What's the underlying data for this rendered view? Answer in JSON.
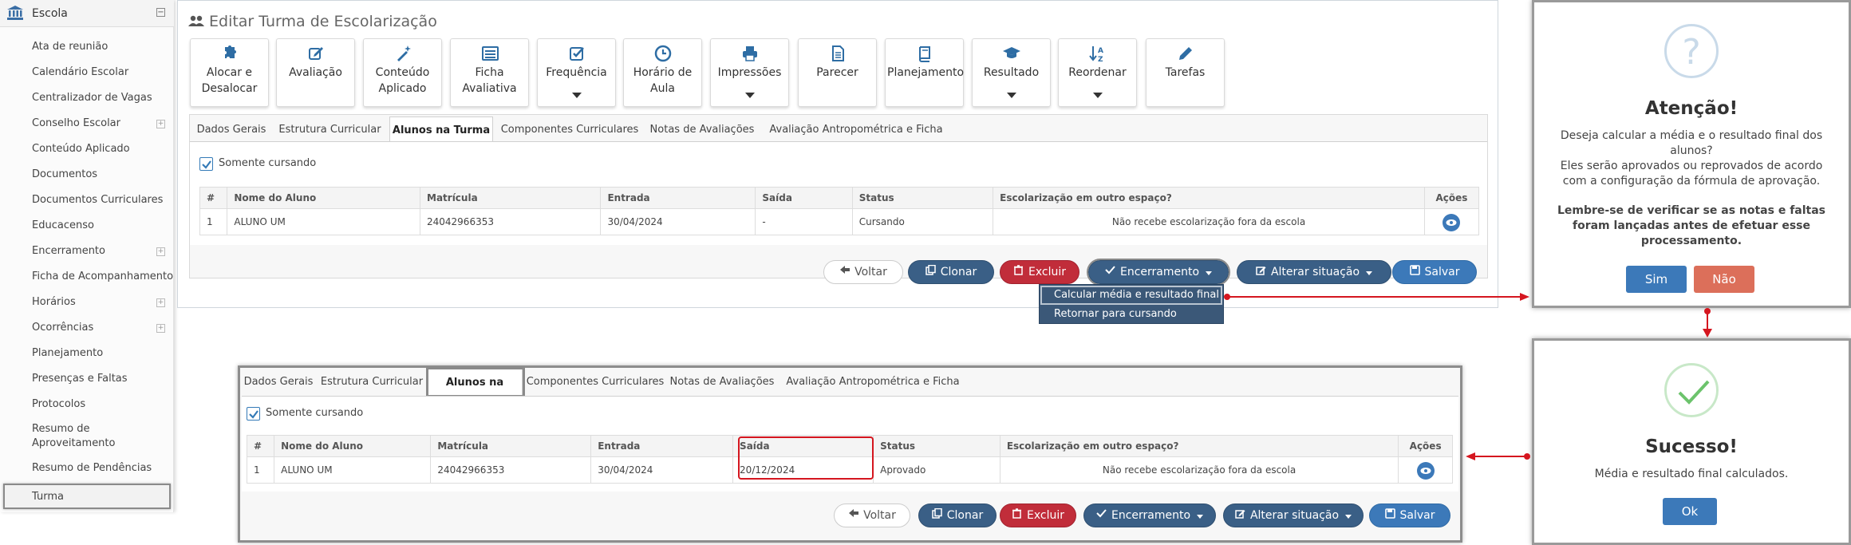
{
  "sidebar": {
    "header": "Escola",
    "items": [
      {
        "label": "Ata de reunião",
        "expandable": false
      },
      {
        "label": "Calendário Escolar",
        "expandable": false
      },
      {
        "label": "Centralizador de Vagas",
        "expandable": false
      },
      {
        "label": "Conselho Escolar",
        "expandable": true
      },
      {
        "label": "Conteúdo Aplicado",
        "expandable": false
      },
      {
        "label": "Documentos",
        "expandable": false
      },
      {
        "label": "Documentos Curriculares",
        "expandable": false
      },
      {
        "label": "Educacenso",
        "expandable": false
      },
      {
        "label": "Encerramento",
        "expandable": true
      },
      {
        "label": "Ficha de Acompanhamento",
        "expandable": false
      },
      {
        "label": "Horários",
        "expandable": true
      },
      {
        "label": "Ocorrências",
        "expandable": true
      },
      {
        "label": "Planejamento",
        "expandable": false
      },
      {
        "label": "Presenças e Faltas",
        "expandable": false
      },
      {
        "label": "Protocolos",
        "expandable": false
      },
      {
        "label": "Resumo de",
        "label2": "Aproveitamento",
        "expandable": false
      },
      {
        "label": "Resumo de Pendências",
        "expandable": false
      },
      {
        "label": "Turma",
        "expandable": false
      }
    ]
  },
  "page": {
    "title": "Editar Turma de Escolarização"
  },
  "toolbar": [
    {
      "l1": "Alocar e",
      "l2": "Desalocar",
      "icon": "puzzle-icon",
      "caret": false
    },
    {
      "l1": "Avaliação",
      "l2": "",
      "icon": "edit-icon",
      "caret": false
    },
    {
      "l1": "Conteúdo",
      "l2": "Aplicado",
      "icon": "magic-wand-icon",
      "caret": false
    },
    {
      "l1": "Ficha",
      "l2": "Avaliativa",
      "icon": "list-icon",
      "caret": false
    },
    {
      "l1": "Frequência",
      "l2": "",
      "icon": "check-square-icon",
      "caret": true
    },
    {
      "l1": "Horário de",
      "l2": "Aula",
      "icon": "clock-icon",
      "caret": false
    },
    {
      "l1": "Impressões",
      "l2": "",
      "icon": "printer-icon",
      "caret": true
    },
    {
      "l1": "Parecer",
      "l2": "",
      "icon": "document-icon",
      "caret": false
    },
    {
      "l1": "Planejamento",
      "l2": "",
      "icon": "book-icon",
      "caret": false
    },
    {
      "l1": "Resultado",
      "l2": "",
      "icon": "graduation-cap-icon",
      "caret": true
    },
    {
      "l1": "Reordenar",
      "l2": "",
      "icon": "sort-az-icon",
      "caret": true
    },
    {
      "l1": "Tarefas",
      "l2": "",
      "icon": "pencil-icon",
      "caret": false
    }
  ],
  "tabs": [
    "Dados Gerais",
    "Estrutura Curricular",
    "Alunos na Turma",
    "Componentes Curriculares",
    "Notas de Avaliações",
    "Avaliação Antropométrica e Ficha Médica"
  ],
  "active_tab": "Alunos na Turma",
  "filter_label": "Somente cursando",
  "table": {
    "headers": [
      "#",
      "Nome do Aluno",
      "Matrícula",
      "Entrada",
      "Saída",
      "Status",
      "Escolarização em outro espaço?",
      "Ações"
    ],
    "row_before": [
      "1",
      "ALUNO UM",
      "24042966353",
      "30/04/2024",
      "-",
      "Cursando",
      "Não recebe escolarização fora da escola"
    ],
    "row_after": [
      "1",
      "ALUNO UM",
      "24042966353",
      "30/04/2024",
      "20/12/2024",
      "Aprovado",
      "Não recebe escolarização fora da escola"
    ]
  },
  "actions": {
    "voltar": "Voltar",
    "clonar": "Clonar",
    "excluir": "Excluir",
    "encerramento": "Encerramento",
    "alterar": "Alterar situação",
    "salvar": "Salvar"
  },
  "dropdown": [
    "Calcular média e resultado final",
    "Retornar para cursando"
  ],
  "confirm_modal": {
    "icon": "?",
    "title": "Atenção!",
    "p1": [
      "Deseja calcular a média e o resultado final dos",
      "alunos?",
      "Eles serão aprovados ou reprovados de acordo",
      "com a configuração da fórmula de aprovação."
    ],
    "p2": [
      "Lembre-se de verificar se as notas e faltas",
      "foram lançadas antes de efetuar esse",
      "processamento."
    ],
    "yes": "Sim",
    "no": "Não"
  },
  "success_modal": {
    "title": "Sucesso!",
    "text": "Média e resultado final calculados.",
    "ok": "Ok"
  },
  "colors": {
    "primary": "#3c79b9",
    "danger": "#c12d3a",
    "dark": "#3a5f86",
    "annotation": "#d5161f",
    "success": "#6cc36c"
  }
}
